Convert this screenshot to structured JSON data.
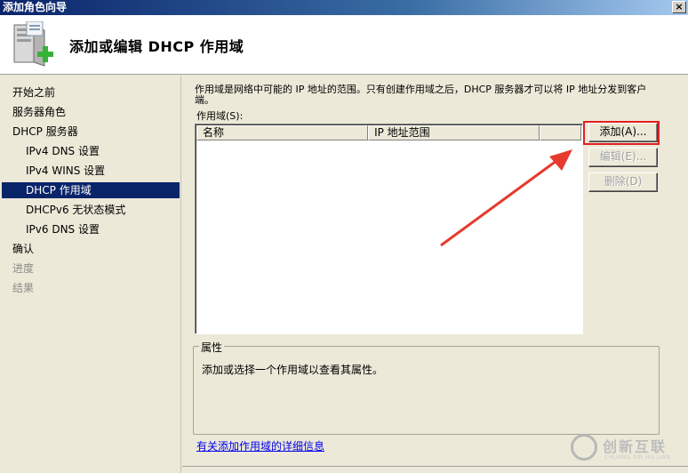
{
  "window": {
    "title": "添加角色向导",
    "close_label": "×"
  },
  "header": {
    "title": "添加或编辑 DHCP 作用域",
    "icon": "server-role-add-icon"
  },
  "nav": {
    "items": [
      {
        "label": "开始之前",
        "state": "normal",
        "level": 0
      },
      {
        "label": "服务器角色",
        "state": "normal",
        "level": 0
      },
      {
        "label": "DHCP 服务器",
        "state": "normal",
        "level": 0
      },
      {
        "label": "IPv4 DNS 设置",
        "state": "normal",
        "level": 1
      },
      {
        "label": "IPv4 WINS 设置",
        "state": "normal",
        "level": 1
      },
      {
        "label": "DHCP 作用域",
        "state": "selected",
        "level": 1
      },
      {
        "label": "DHCPv6 无状态模式",
        "state": "normal",
        "level": 1
      },
      {
        "label": "IPv6 DNS 设置",
        "state": "normal",
        "level": 1
      },
      {
        "label": "确认",
        "state": "normal",
        "level": 0
      },
      {
        "label": "进度",
        "state": "disabled",
        "level": 0
      },
      {
        "label": "结果",
        "state": "disabled",
        "level": 0
      }
    ]
  },
  "main": {
    "description": "作用域是网络中可能的 IP 地址的范围。只有创建作用域之后，DHCP 服务器才可以将 IP 地址分发到客户端。",
    "scope_label": "作用域(S):",
    "columns": [
      "名称",
      "IP 地址范围",
      ""
    ],
    "buttons": {
      "add": "添加(A)...",
      "edit": "编辑(E)...",
      "delete": "删除(D)"
    },
    "properties": {
      "legend": "属性",
      "text": "添加或选择一个作用域以查看其属性。"
    },
    "help_link": "有关添加作用域的详细信息"
  },
  "watermark": {
    "brand": "创新互联",
    "sub": "CHUANG XIN HU LIAN"
  },
  "colors": {
    "selection": "#0a246a",
    "highlight": "#e21f1f",
    "link": "#0000ee"
  }
}
